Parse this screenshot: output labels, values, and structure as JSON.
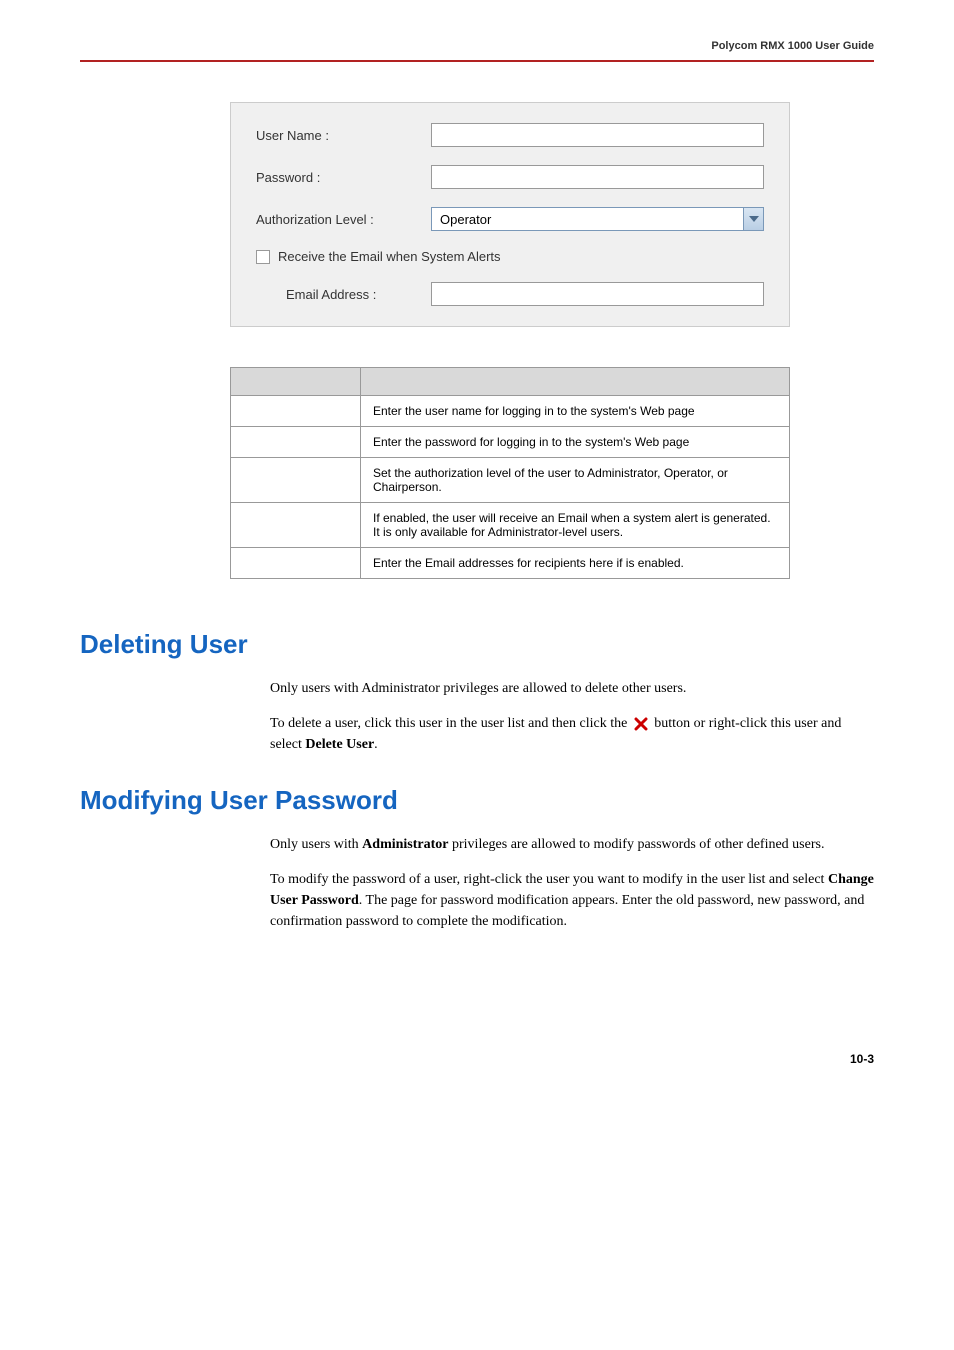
{
  "header": {
    "guide_title": "Polycom RMX 1000 User Guide"
  },
  "app_panel": {
    "user_name_label": "User Name :",
    "user_name_value": "",
    "password_label": "Password :",
    "password_value": "",
    "auth_level_label": "Authorization Level :",
    "auth_level_value": "Operator",
    "checkbox_label": "Receive the Email when System Alerts",
    "email_label": "Email Address :",
    "email_value": ""
  },
  "params_table": {
    "rows": [
      {
        "desc": "Enter the user name for logging in to the system's Web page"
      },
      {
        "desc": "Enter the password for logging in to the system's Web page"
      },
      {
        "desc": "Set the authorization level of the user to Administrator, Operator, or Chairperson."
      },
      {
        "desc": "If enabled, the user will receive an Email when a system alert is generated. It is only available for Administrator-level users."
      },
      {
        "desc_prefix": "Enter the Email addresses for recipients here if ",
        "desc_suffix": "is enabled."
      }
    ]
  },
  "sections": {
    "deleting_user": {
      "heading": "Deleting User",
      "p1": "Only users with Administrator privileges are allowed to delete other users.",
      "p2_a": "To delete a user, click this user in the user list and then click the ",
      "p2_b": " button or right-click this user and select ",
      "p2_bold": "Delete User",
      "p2_c": "."
    },
    "modifying_password": {
      "heading": "Modifying User Password",
      "p1_a": "Only users with ",
      "p1_bold": "Administrator",
      "p1_b": " privileges are allowed to modify passwords of other defined users.",
      "p2_a": "To modify the password of a user, right-click the user you want to modify in the user list and select ",
      "p2_bold": "Change User Password",
      "p2_b": ". The page for password modification appears. Enter the old password, new password, and confirmation password to complete the modification."
    }
  },
  "footer": {
    "page_number": "10-3"
  }
}
